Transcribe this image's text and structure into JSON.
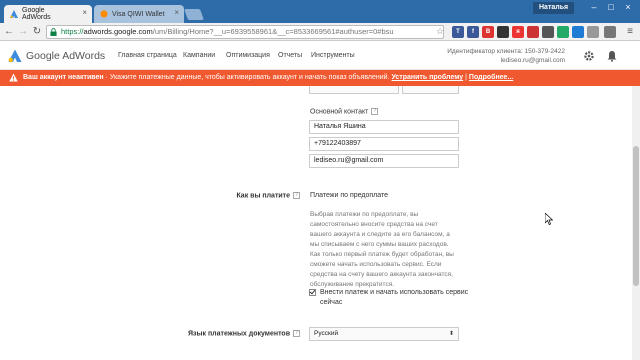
{
  "browser": {
    "tabs": [
      {
        "title": "Google AdWords",
        "active": true
      },
      {
        "title": "Visa QIWI Wallet",
        "active": false
      }
    ],
    "window_user": "Наталья",
    "url": {
      "scheme": "https://",
      "host": "adwords.google.com",
      "path": "/um/Billing/Home?__u=6939558961&__c=8533669561#authuser=0#bsu"
    },
    "extensions": [
      {
        "label": "T",
        "color": "#3b5998"
      },
      {
        "label": "f",
        "color": "#3b5998"
      },
      {
        "label": "B",
        "color": "#d33"
      },
      {
        "label": "я",
        "color": "#e33"
      },
      {
        "label": "",
        "color": "#555"
      },
      {
        "label": "",
        "color": "#1e7cd4"
      }
    ]
  },
  "adwords": {
    "logo_text": "Google AdWords",
    "nav": [
      "Главная страница",
      "Кампании",
      "Оптимизация",
      "Отчеты",
      "Инструменты"
    ],
    "client_id_label": "Идентификатор клиента: 150-379-2422",
    "client_email": "lediseo.ru@gmail.com",
    "accent_color": "#f0582f"
  },
  "alert": {
    "bold": "Ваш аккаунт неактивен",
    "text": " · Укажите платежные данные, чтобы активировать аккаунт и начать показ объявлений.",
    "link1": "Устранить проблему",
    "separator": " | ",
    "link2": "Подробнее..."
  },
  "form": {
    "contact_label": "Основной контакт",
    "contact_name": "Наталья Яшина",
    "phone": "+79122403897",
    "email": "lediseo.ru@gmail.com",
    "how_pay_label": "Как вы платите",
    "pay_method": "Платежи по предоплате",
    "pay_desc": "Выбрав платежи по предоплате, вы самостоятельно вносите средства на счет вашего аккаунта и следите за его балансом, а мы списываем с него суммы ваших расходов. Как только первый платеж будет обработан, вы сможете начать использовать сервис. Если средства на счету вашего аккаунта закончатся, обслуживание прекратится.",
    "checkbox_label": "Внести платеж и начать использовать сервис сейчас",
    "doc_lang_label": "Язык платежных документов",
    "doc_lang_value": "Русский"
  }
}
